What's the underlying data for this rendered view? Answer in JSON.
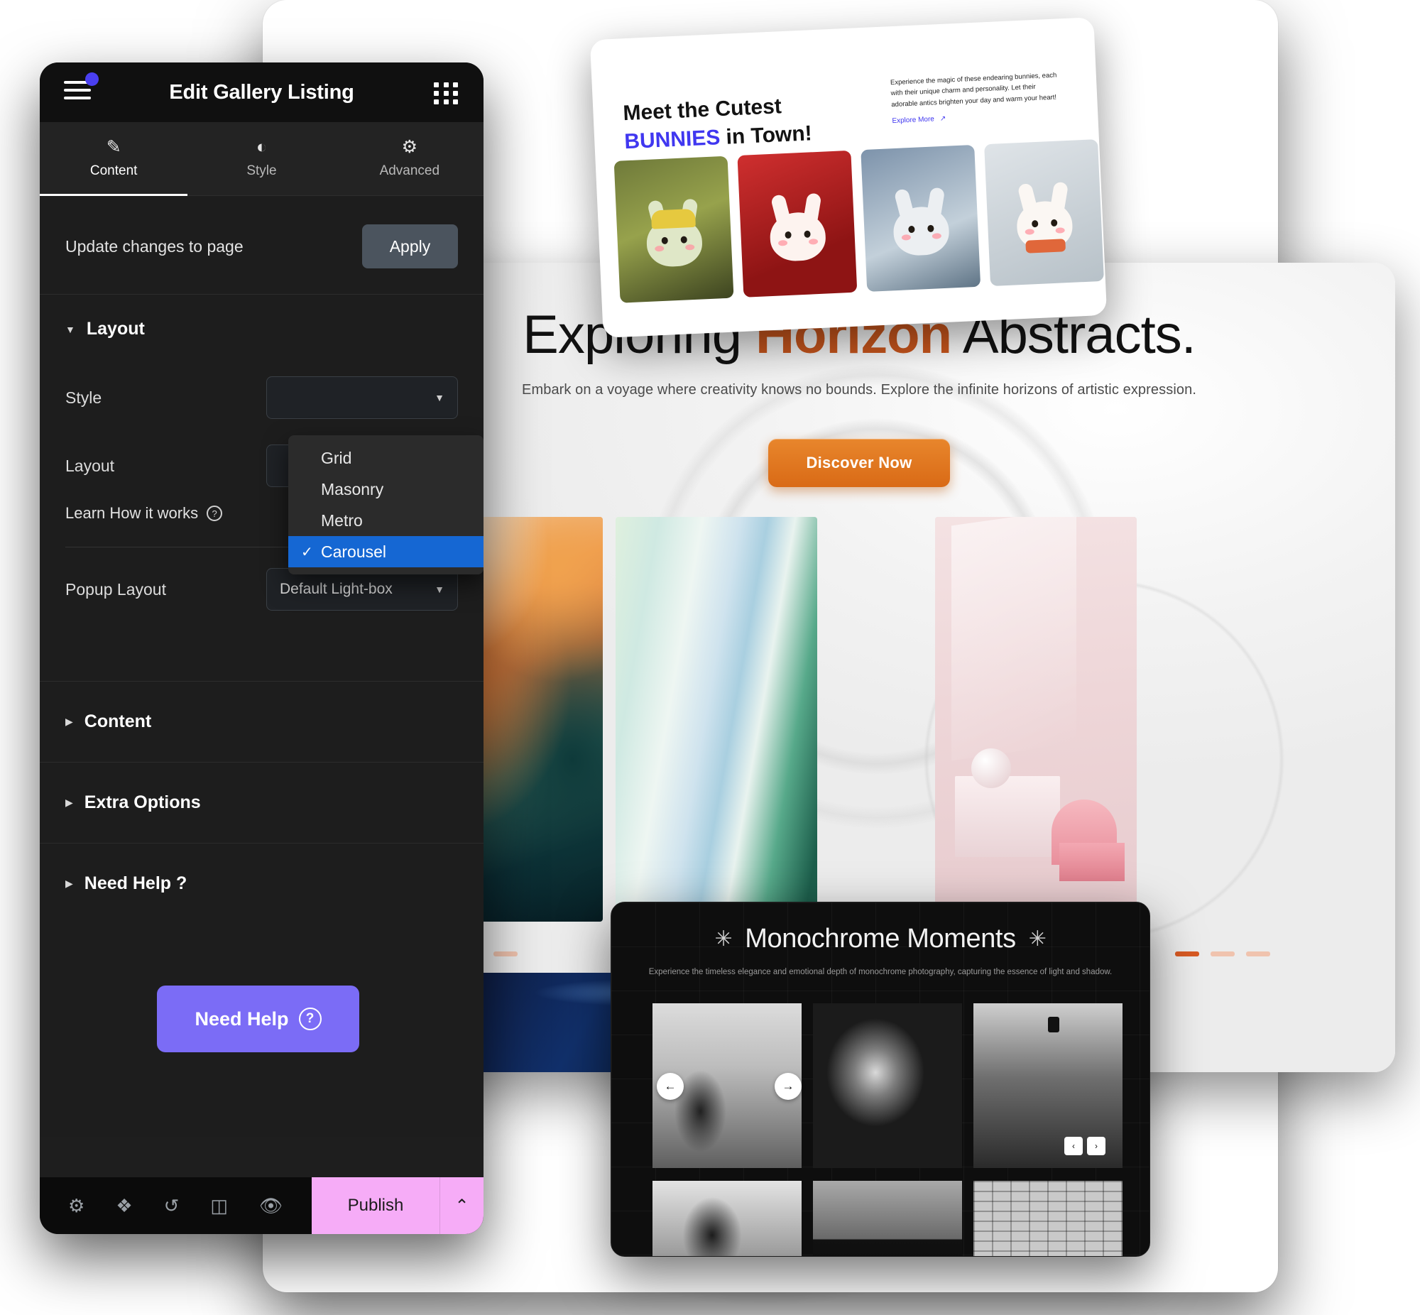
{
  "editor": {
    "title": "Edit Gallery Listing",
    "menu_icon": "hamburger-icon",
    "grid_icon": "app-grid-icon",
    "tabs": [
      {
        "label": "Content",
        "icon": "pencil-icon",
        "active": true
      },
      {
        "label": "Style",
        "icon": "contrast-icon",
        "active": false
      },
      {
        "label": "Advanced",
        "icon": "gear-icon",
        "active": false
      }
    ],
    "apply_row": {
      "label": "Update changes to page",
      "button": "Apply"
    },
    "layout_section": {
      "title": "Layout",
      "expanded": true,
      "style_label": "Style",
      "layout_label": "Layout",
      "learn_link": "Learn How it works",
      "popup_label": "Popup Layout",
      "popup_value": "Default Light-box"
    },
    "dropdown": {
      "options": [
        "Grid",
        "Masonry",
        "Metro",
        "Carousel"
      ],
      "selected": "Carousel",
      "check_glyph": "✓"
    },
    "sections": [
      {
        "title": "Content",
        "expanded": false
      },
      {
        "title": "Extra Options",
        "expanded": false
      },
      {
        "title": "Need Help ?",
        "expanded": false
      }
    ],
    "need_help_button": "Need Help",
    "footer": {
      "icons": [
        "gear-icon",
        "layers-icon",
        "history-icon",
        "responsive-icon",
        "eye-icon"
      ],
      "publish_label": "Publish",
      "caret_glyph": "⌃"
    },
    "colors": {
      "panel_bg": "#1d1d1d",
      "header_bg": "#101010",
      "accent_purple": "#7b6cf6",
      "dropdown_selected": "#1567d3",
      "publish_pink": "#f6acf7"
    }
  },
  "bunny_card": {
    "title_line1": "Meet the Cutest",
    "title_highlight": "BUNNIES",
    "title_rest": " in Town!",
    "paragraph": "Experience the magic of these endearing bunnies, each with their unique charm and personality. Let their adorable antics brighten your day and warm your heart!",
    "link_label": "Explore More",
    "link_icon": "arrow-up-right-icon",
    "images": [
      {
        "alt": "bunny-in-yellow-hat"
      },
      {
        "alt": "bunny-on-red-background"
      },
      {
        "alt": "bunny-with-bunny-ears-hat"
      },
      {
        "alt": "bunny-with-orange-scarf"
      }
    ],
    "highlight_color": "#4037f0"
  },
  "hero": {
    "title_before": "Exploring ",
    "title_accent": "Horizon",
    "title_after": " Abstracts.",
    "subtitle": "Embark on a voyage where creativity knows no bounds. Explore the infinite horizons of artistic expression.",
    "cta_label": "Discover Now",
    "cta_color": "#d96a16",
    "accent_color": "#c8561d",
    "tiles": [
      {
        "alt": "abstract-flowing-orange-teal-art"
      },
      {
        "alt": "abstract-green-blue-waves-art"
      },
      {
        "alt": "pink-still-life-shapes"
      }
    ],
    "pagination_left": {
      "total": 3,
      "active": 1
    },
    "pagination_right": {
      "total": 3,
      "active": 1
    }
  },
  "mono_panel": {
    "title": "Monochrome Moments",
    "star_glyph": "✳",
    "subtitle": "Experience the timeless elegance and emotional depth of monochrome photography, capturing the essence of light and shadow.",
    "nav_prev": "←",
    "nav_next": "→",
    "mini_prev": "‹",
    "mini_next": "›",
    "images_row1": [
      {
        "alt": "foggy-pine-tree-bw"
      },
      {
        "alt": "smoke-portrait-bw"
      },
      {
        "alt": "misty-street-lamp-bw"
      }
    ],
    "images_row2": [
      {
        "alt": "tree-silhouette-bw"
      },
      {
        "alt": "dunes-bw"
      },
      {
        "alt": "brick-wall-bw"
      }
    ]
  }
}
